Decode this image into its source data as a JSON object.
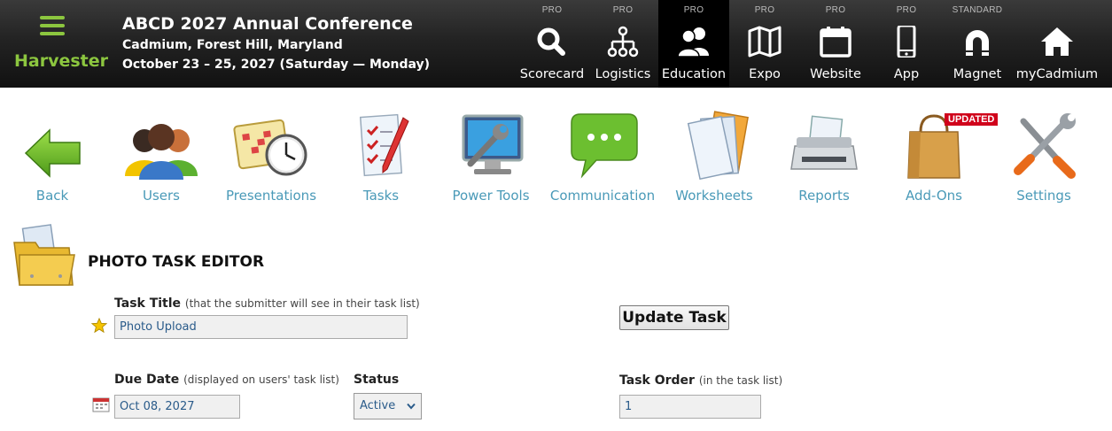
{
  "header": {
    "brand": "Harvester",
    "conference_title": "ABCD 2027 Annual Conference",
    "location": "Cadmium, Forest Hill, Maryland",
    "dates": "October 23 – 25, 2027 (Saturday — Monday)"
  },
  "modules": [
    {
      "tier": "PRO",
      "label": "Scorecard",
      "icon": "search-icon"
    },
    {
      "tier": "PRO",
      "label": "Logistics",
      "icon": "sitemap-icon"
    },
    {
      "tier": "PRO",
      "label": "Education",
      "icon": "users-icon",
      "active": true
    },
    {
      "tier": "PRO",
      "label": "Expo",
      "icon": "map-icon"
    },
    {
      "tier": "PRO",
      "label": "Website",
      "icon": "calendar-icon"
    },
    {
      "tier": "PRO",
      "label": "App",
      "icon": "mobile-icon"
    },
    {
      "tier": "STANDARD",
      "label": "Magnet",
      "icon": "magnet-icon"
    },
    {
      "tier": "",
      "label": "myCadmium",
      "icon": "home-icon"
    }
  ],
  "toolbar": [
    {
      "label": "Back",
      "icon": "back-arrow-icon"
    },
    {
      "label": "Users",
      "icon": "users-group-icon"
    },
    {
      "label": "Presentations",
      "icon": "calendar-clock-icon"
    },
    {
      "label": "Tasks",
      "icon": "checklist-icon"
    },
    {
      "label": "Power Tools",
      "icon": "monitor-wrench-icon"
    },
    {
      "label": "Communication",
      "icon": "chat-bubble-icon"
    },
    {
      "label": "Worksheets",
      "icon": "documents-icon"
    },
    {
      "label": "Reports",
      "icon": "printer-icon"
    },
    {
      "label": "Add-Ons",
      "icon": "shopping-bag-icon",
      "badge": "UPDATED"
    },
    {
      "label": "Settings",
      "icon": "tools-icon"
    }
  ],
  "editor": {
    "heading": "PHOTO TASK EDITOR",
    "task_title_label": "Task Title",
    "task_title_hint": "(that the submitter will see in their task list)",
    "task_title_value": "Photo Upload",
    "update_button": "Update Task",
    "due_date_label": "Due Date",
    "due_date_hint": "(displayed on users' task list)",
    "due_date_value": "Oct 08, 2027",
    "status_label": "Status",
    "status_value": "Active",
    "task_order_label": "Task Order",
    "task_order_hint": "(in the task list)",
    "task_order_value": "1"
  },
  "colors": {
    "brand_green": "#8cc63f",
    "link_blue": "#4a9ab8",
    "badge_red": "#d0021b"
  }
}
